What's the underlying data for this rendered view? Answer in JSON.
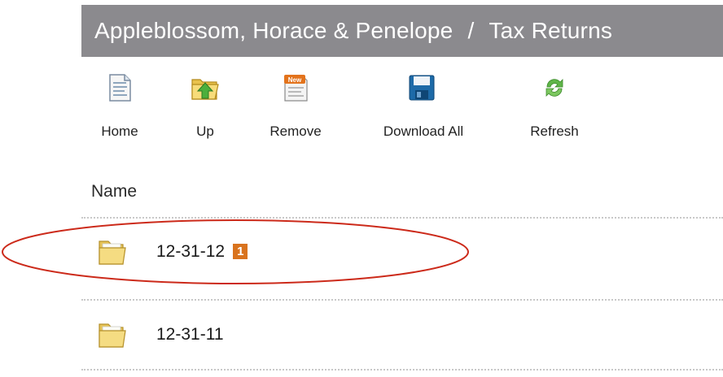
{
  "header": {
    "client": "Appleblossom, Horace & Penelope",
    "separator": "/",
    "folder": "Tax Returns",
    "background_color": "#8b8a8e"
  },
  "toolbar": {
    "buttons": [
      {
        "label": "Home",
        "icon": "home-document-icon"
      },
      {
        "label": "Up",
        "icon": "folder-up-arrow-icon"
      },
      {
        "label": "Remove",
        "icon": "new-document-icon"
      },
      {
        "label": "Download All",
        "icon": "floppy-disk-icon"
      },
      {
        "label": "Refresh",
        "icon": "refresh-arrows-icon"
      }
    ]
  },
  "list": {
    "column_header": "Name",
    "rows": [
      {
        "name": "12-31-12",
        "badge": "1",
        "icon": "folder-icon"
      },
      {
        "name": "12-31-11",
        "icon": "folder-icon"
      }
    ]
  },
  "annotation": {
    "highlight_color": "#cc2a1a",
    "highlighted_row": "12-31-12"
  },
  "colors": {
    "badge": "#d9731e"
  }
}
